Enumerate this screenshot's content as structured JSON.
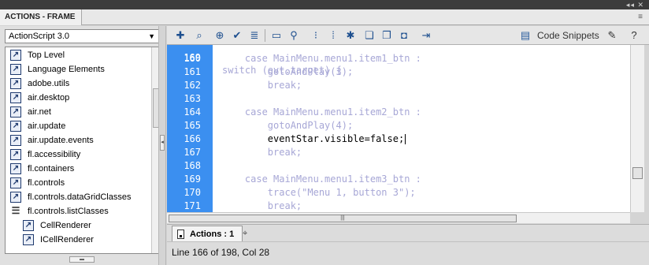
{
  "panel": {
    "title": "ACTIONS - FRAME",
    "window_controls": "◂◂ ✕",
    "menu_icon": "≡"
  },
  "left": {
    "dropdown_value": "ActionScript 3.0",
    "tree": [
      {
        "label": "Top Level",
        "icon": "package-icon"
      },
      {
        "label": "Language Elements",
        "icon": "package-icon"
      },
      {
        "label": "adobe.utils",
        "icon": "package-icon"
      },
      {
        "label": "air.desktop",
        "icon": "package-icon"
      },
      {
        "label": "air.net",
        "icon": "package-icon"
      },
      {
        "label": "air.update",
        "icon": "package-icon"
      },
      {
        "label": "air.update.events",
        "icon": "package-icon"
      },
      {
        "label": "fl.accessibility",
        "icon": "package-icon"
      },
      {
        "label": "fl.containers",
        "icon": "package-icon"
      },
      {
        "label": "fl.controls",
        "icon": "package-icon"
      },
      {
        "label": "fl.controls.dataGridClasses",
        "icon": "package-icon"
      },
      {
        "label": "fl.controls.listClasses",
        "icon": "open-package-icon"
      },
      {
        "label": "CellRenderer",
        "icon": "class-icon"
      },
      {
        "label": "ICellRenderer",
        "icon": "class-icon"
      }
    ]
  },
  "toolbar": {
    "code_snippets_label": "Code Snippets",
    "icons": [
      "add-statement-icon",
      "find-icon",
      "insert-target-path-icon",
      "check-syntax-icon",
      "auto-format-icon",
      "code-hint-icon",
      "debug-options-icon",
      "collapse-between-braces-icon",
      "collapse-selection-icon",
      "expand-all-icon",
      "apply-block-comment-icon",
      "apply-line-comment-icon",
      "remove-comment-icon",
      "show-hide-toolbox-icon",
      "code-snippets-icon",
      "wizard-icon",
      "help-icon"
    ]
  },
  "editor": {
    "lines": [
      {
        "num": "160",
        "code": "    case MainMenu.menu1.item1_btn :"
      },
      {
        "num": "161",
        "code": "        gotoAndPlay(3);"
      },
      {
        "num": "162",
        "code": "        break;"
      },
      {
        "num": "163",
        "code": ""
      },
      {
        "num": "164",
        "code": "    case MainMenu.menu1.item2_btn :"
      },
      {
        "num": "165",
        "code": "        gotoAndPlay(4);"
      },
      {
        "num": "166",
        "code": "        eventStar.visible=false;"
      },
      {
        "num": "167",
        "code": "        break;"
      },
      {
        "num": "168",
        "code": ""
      },
      {
        "num": "169",
        "code": "    case MainMenu.menu1.item3_btn :"
      },
      {
        "num": "170",
        "code": "        trace(\"Menu 1, button 3\");"
      },
      {
        "num": "171",
        "code": "        break;"
      }
    ],
    "partial_top": {
      "num": "169",
      "code": "switch (evt.target) {"
    }
  },
  "bottom_tab": "Actions : 1",
  "status": "Line 166 of 198, Col 28"
}
